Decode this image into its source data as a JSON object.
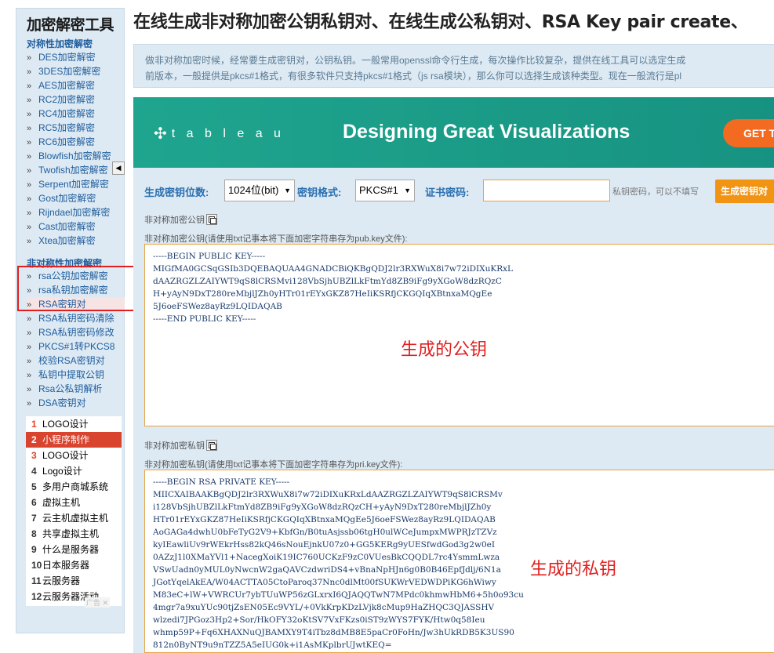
{
  "sidebar": {
    "title": "加密解密工具",
    "symmetric_title": "对称性加密解密",
    "symmetric_items": [
      "DES加密解密",
      "3DES加密解密",
      "AES加密解密",
      "RC2加密解密",
      "RC4加密解密",
      "RC5加密解密",
      "RC6加密解密",
      "Blowfish加密解密",
      "Twofish加密解密",
      "Serpent加密解密",
      "Gost加密解密",
      "Rijndael加密解密",
      "Cast加密解密",
      "Xtea加密解密"
    ],
    "asymmetric_title": "非对称性加密解密",
    "asymmetric_items": [
      "rsa公钥加密解密",
      "rsa私钥加密解密",
      "RSA密钥对",
      "RSA私钥密码清除",
      "RSA私钥密码修改",
      "PKCS#1转PKCS8",
      "校验RSA密钥对",
      "私钥中提取公钥",
      "Rsa公私钥解析",
      "DSA密钥对"
    ],
    "active_item": "RSA密钥对",
    "collapse_glyph": "◀"
  },
  "ranking": {
    "items": [
      {
        "num": "1",
        "label": "LOGO设计"
      },
      {
        "num": "2",
        "label": "小程序制作"
      },
      {
        "num": "3",
        "label": "LOGO设计"
      },
      {
        "num": "4",
        "label": "Logo设计"
      },
      {
        "num": "5",
        "label": "多用户商城系统"
      },
      {
        "num": "6",
        "label": "虚拟主机"
      },
      {
        "num": "7",
        "label": "云主机虚拟主机"
      },
      {
        "num": "8",
        "label": "共享虚拟主机"
      },
      {
        "num": "9",
        "label": "什么是服务器"
      },
      {
        "num": "10",
        "label": "日本服务器"
      },
      {
        "num": "11",
        "label": "云服务器"
      },
      {
        "num": "12",
        "label": "云服务器活动"
      }
    ],
    "ad_label": "广告 ✕"
  },
  "page": {
    "title": "在线生成非对称加密公钥私钥对、在线生成公私钥对、RSA Key pair create、",
    "description_line1": "做非对称加密时候，经常要生成密钥对，公钥私钥。一般常用openssl命令行生成，每次操作比较复杂，提供在线工具可以选定生成",
    "description_line2": "前版本，一般提供是pkcs#1格式，有很多软件只支持pkcs#1格式（js rsa模块），那么你可以选择生成该种类型。现在一般流行是pl"
  },
  "banner": {
    "logo": "t a b l e a u",
    "logo_glyph": "✣",
    "headline": "Designing Great Visualizations",
    "cta": "GET T"
  },
  "form": {
    "bits_label": "生成密钥位数:",
    "bits_value": "1024位(bit)",
    "format_label": "密钥格式:",
    "format_value": "PKCS#1",
    "password_label": "证书密码:",
    "password_value": "",
    "password_hint": "私钥密码，可以不填写",
    "generate_button": "生成密钥对"
  },
  "public_key": {
    "short_label": "非对称加密公钥",
    "label": "非对称加密公钥(请使用txt记事本将下面加密字符串存为pub.key文件):",
    "value": "-----BEGIN PUBLIC KEY-----\nMIGfMA0GCSqGSIb3DQEBAQUAA4GNADCBiQKBgQDJ2lr3RXWuX8i7w72iDIXuKRxL\ndAAZRGZLZAIYWT9qS8lCRSMvi128VbSjhUBZlLkFtmYd8ZB9iFg9yXGoW8dzRQzC\nH+yAyN9DxT280reMbjlJZh0yHTr01rEYxGKZ87HeIiKSRfjCKGQIqXBtnxaMQgEe\n5J6oeFSWez8ayRz9LQIDAQAB\n-----END PUBLIC KEY-----",
    "annotation": "生成的公钥"
  },
  "private_key": {
    "short_label": "非对称加密私钥",
    "label": "非对称加密私钥(请使用txt记事本将下面加密字符串存为pri.key文件):",
    "value": "-----BEGIN RSA PRIVATE KEY-----\nMIICXAIBAAKBgQDJ2lr3RXWuX8i7w72iDIXuKRxLdAAZRGZLZAIYWT9qS8lCRSMv\ni128VbSjhUBZlLkFtmYd8ZB9iFg9yXGoW8dzRQzCH+yAyN9DxT280reMbjlJZh0y\nHTr01rEYxGKZ87HeIiKSRfjCKGQIqXBtnxaMQgEe5J6oeFSWez8ayRz9LQIDAQAB\nAoGAGa4dwhU0bFeTyG2V9+KbfGn/B0tuAsjssb06tgH0ulWCeJumpxMWPRJzTZVz\nkyIEawliUv9rWEkrHss82kQ46sNouEjnkU07z0+GG5KERg9yUESfwdGod3g2w0eI\n0AZzJ1l0XMaYVl1+NacegXoiK19IC760UCKzF9zC0VUesBkCQQDL7rc4YsmmLwza\nVSwUadn0yMUL0yNwcnW2gaQAVCzdwriDS4+vBnaNpHJn6g0B0B46EpfJdlj/6N1a\nJGotYqelAkEA/W04ACTTA05CtoParoq37Nnc0dlMt00fSUKWrVEDWDPiKG6hWiwy\nM83eC+lW+VWRCUr7ybTUuWP56zGLxrxI6QJAQQTwN7MPdc0khmwHbM6+5h0o93cu\n4mgr7a9xuYUc90tjZsEN05Ec9VYL/+0VkKrpKDzLVjk8cMup9HaZHQC3QJASSHV\nwlzedi7JPGoz3Hp2+Sor/HkOFY32oKtSV7VxFKzs0iST9zWYS7FYK/Htw0q58Ieu\nwhmp59P+Fq6XHAXNuQJBAMXY9T4iTbz8dMB8E5paCr0FoHn/Jw3hUkRDB5K3US90\n812n0ByNT9u9nTZZ5A5eIUG0k+i1AsMKplbrUJwtKEQ=",
    "annotation": "生成的私钥"
  }
}
